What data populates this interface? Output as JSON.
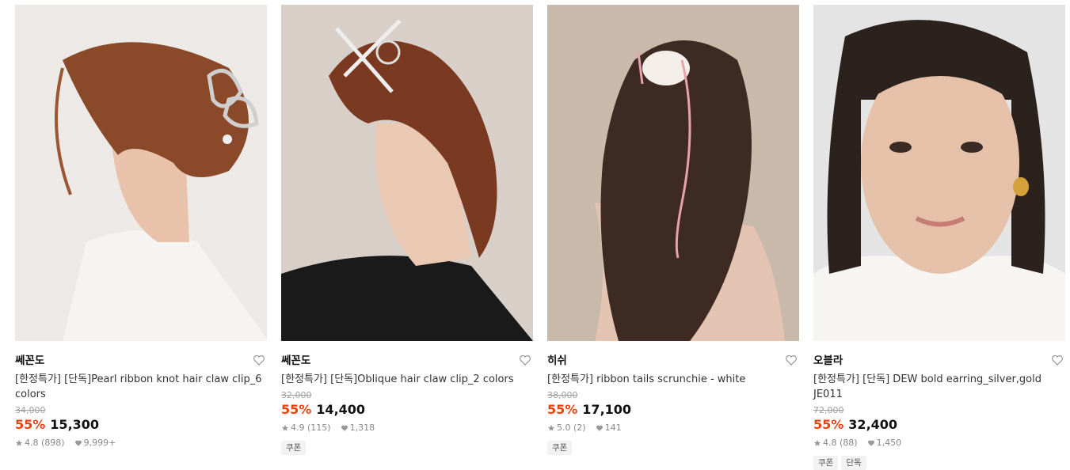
{
  "products": [
    {
      "brand": "쎄꼰도",
      "name": "[한정특가] [단독]Pearl ribbon knot hair claw clip_6 colors",
      "original_price": "34,000",
      "discount": "55%",
      "price": "15,300",
      "rating": "4.8 (898)",
      "likes": "9,999+",
      "tags": [],
      "image": {
        "bg": "#ece9e6",
        "hair": "#8a4a2a",
        "skin": "#e8c2aa",
        "cloth": "#f6f4f2",
        "icon": "hair-claw-photo"
      }
    },
    {
      "brand": "쎄꼰도",
      "name": "[한정특가] [단독]Oblique hair claw clip_2 colors",
      "original_price": "32,000",
      "discount": "55%",
      "price": "14,400",
      "rating": "4.9 (115)",
      "likes": "1,318",
      "tags": [
        "쿠폰"
      ],
      "image": {
        "bg": "#d9cfc9",
        "hair": "#7a3a22",
        "skin": "#e9c8b4",
        "cloth": "#1a1a1a",
        "icon": "hair-claw-photo"
      }
    },
    {
      "brand": "히쉬",
      "name": "[한정특가] ribbon tails scrunchie - white",
      "original_price": "38,000",
      "discount": "55%",
      "price": "17,100",
      "rating": "5.0 (2)",
      "likes": "141",
      "tags": [
        "쿠폰"
      ],
      "image": {
        "bg": "#c9b9ab",
        "hair": "#3d2a22",
        "skin": "#e3c3b1",
        "cloth": "#e3c3b1",
        "icon": "scrunchie-photo"
      }
    },
    {
      "brand": "오블라",
      "name": "[한정특가] [단독] DEW bold earring_silver,gold JE011",
      "original_price": "72,000",
      "discount": "55%",
      "price": "32,400",
      "rating": "4.8 (88)",
      "likes": "1,450",
      "tags": [
        "쿠폰",
        "단독"
      ],
      "image": {
        "bg": "#e4e4e4",
        "hair": "#2b211d",
        "skin": "#e6c1aa",
        "cloth": "#f7f5f2",
        "icon": "earring-photo"
      }
    }
  ],
  "colors": {
    "discount": "#f2400d",
    "muted": "#888888",
    "tag_bg": "#f2f2f2"
  }
}
